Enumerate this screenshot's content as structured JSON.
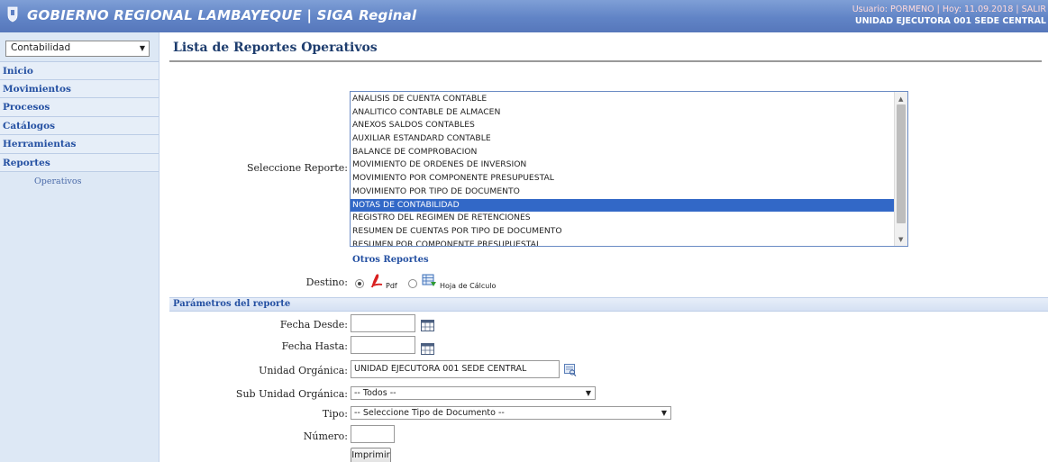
{
  "header": {
    "title": "GOBIERNO REGIONAL LAMBAYEQUE | SIGA Reginal",
    "user_line": "Usuario: PORMENO | Hoy: 11.09.2018 | SALIR",
    "unit_line": "UNIDAD EJECUTORA 001 SEDE CENTRAL"
  },
  "sidebar": {
    "module_select": "Contabilidad",
    "menu": [
      {
        "label": "Inicio"
      },
      {
        "label": "Movimientos"
      },
      {
        "label": "Procesos"
      },
      {
        "label": "Catálogos"
      },
      {
        "label": "Herramientas"
      },
      {
        "label": "Reportes"
      }
    ],
    "submenu": [
      {
        "label": "Operativos"
      }
    ]
  },
  "main": {
    "page_title": "Lista de Reportes Operativos",
    "select_report_label": "Seleccione Reporte:",
    "reports": [
      "ANALISIS DE CUENTA CONTABLE",
      "ANALITICO CONTABLE DE ALMACEN",
      "ANEXOS SALDOS CONTABLES",
      "AUXILIAR ESTANDARD CONTABLE",
      "BALANCE DE COMPROBACION",
      "MOVIMIENTO DE ORDENES DE INVERSION",
      "MOVIMIENTO POR COMPONENTE PRESUPUESTAL",
      "MOVIMIENTO POR TIPO DE DOCUMENTO",
      "NOTAS DE CONTABILIDAD",
      "REGISTRO DEL REGIMEN DE RETENCIONES",
      "RESUMEN DE CUENTAS POR TIPO DE DOCUMENTO",
      "RESUMEN POR COMPONENTE PRESUPUESTAL"
    ],
    "selected_report": "NOTAS DE CONTABILIDAD",
    "other_reports_label": "Otros Reportes",
    "destino_label": "Destino:",
    "destino_pdf_label": "Pdf",
    "destino_xls_label": "Hoja de Cálculo",
    "destino_selected": "Pdf"
  },
  "params": {
    "header": "Parámetros del reporte",
    "fecha_desde_label": "Fecha Desde:",
    "fecha_desde_value": "",
    "fecha_hasta_label": "Fecha Hasta:",
    "fecha_hasta_value": "",
    "unidad_label": "Unidad Orgánica:",
    "unidad_value": "UNIDAD EJECUTORA 001 SEDE CENTRAL",
    "sub_unidad_label": "Sub Unidad Orgánica:",
    "sub_unidad_value": "-- Todos --",
    "tipo_label": "Tipo:",
    "tipo_value": "-- Seleccione Tipo de Documento --",
    "numero_label": "Número:",
    "numero_value": "",
    "print_label": "Imprimir"
  },
  "colors": {
    "header_blue": "#6184c6",
    "sidebar_bg": "#dde8f5",
    "link_blue": "#2450a2",
    "selection_blue": "#3268c7"
  },
  "icons": [
    "shield-logo-icon",
    "pdf-icon",
    "spreadsheet-icon",
    "calendar-icon",
    "lookup-icon",
    "chevron-down-icon"
  ]
}
